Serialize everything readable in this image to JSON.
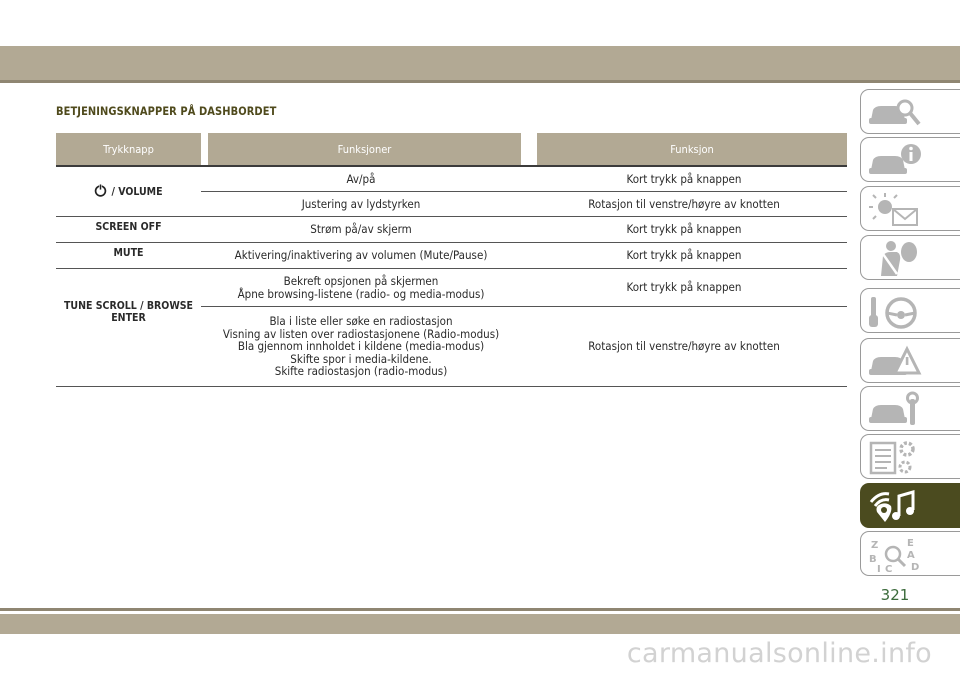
{
  "section_title": "BETJENINGSKNAPPER PÅ DASHBORDET",
  "table": {
    "headers": [
      "Trykknapp",
      "Funksjoner",
      "Funksjon"
    ],
    "volume_key": "/ VOLUME",
    "volume_rows": [
      {
        "function": "Av/på",
        "action": "Kort trykk på knappen"
      },
      {
        "function": "Justering av lydstyrken",
        "action": "Rotasjon til venstre/høyre av knotten"
      }
    ],
    "screen_off": {
      "key": "SCREEN OFF",
      "function": "Strøm på/av skjerm",
      "action": "Kort trykk på knappen"
    },
    "mute": {
      "key": "MUTE",
      "function": "Aktivering/inaktivering av volumen (Mute/Pause)",
      "action": "Kort trykk på knappen"
    },
    "tune_key_line1": "TUNE SCROLL / BROWSE",
    "tune_key_line2": "ENTER",
    "tune_row1": {
      "function_lines": [
        "Bekreft opsjonen på skjermen",
        "Åpne browsing-listene (radio- og media-modus)"
      ],
      "action": "Kort trykk på knappen"
    },
    "tune_row2": {
      "function_lines": [
        "Bla i liste eller søke en radiostasjon",
        "Visning av listen over radiostasjonene (Radio-modus)",
        "Bla gjennom innholdet i kildene (media-modus)",
        "Skifte spor i media-kildene.",
        "Skifte radiostasjon (radio-modus)"
      ],
      "action": "Rotasjon til venstre/høyre av knotten"
    }
  },
  "sidebar": {
    "tabs": [
      {
        "icon": "car-search-icon"
      },
      {
        "icon": "car-info-icon"
      },
      {
        "icon": "warning-light-message-icon"
      },
      {
        "icon": "seatbelt-airbag-icon"
      },
      {
        "icon": "key-steering-wheel-icon"
      },
      {
        "icon": "car-hazard-icon"
      },
      {
        "icon": "car-wrench-icon"
      },
      {
        "icon": "specifications-gear-icon"
      },
      {
        "icon": "multimedia-icon",
        "active": true
      },
      {
        "icon": "index-letters-icon",
        "letters": [
          "Z",
          "E",
          "B",
          "A",
          "C",
          "I",
          "D"
        ]
      }
    ]
  },
  "page_number": "321",
  "watermark": "carmanualsonline.info",
  "colors": {
    "band": "#b2a994",
    "title": "#4f4a1c",
    "active_tab": "#4b4b1f",
    "page_number": "#3c6b3c"
  }
}
